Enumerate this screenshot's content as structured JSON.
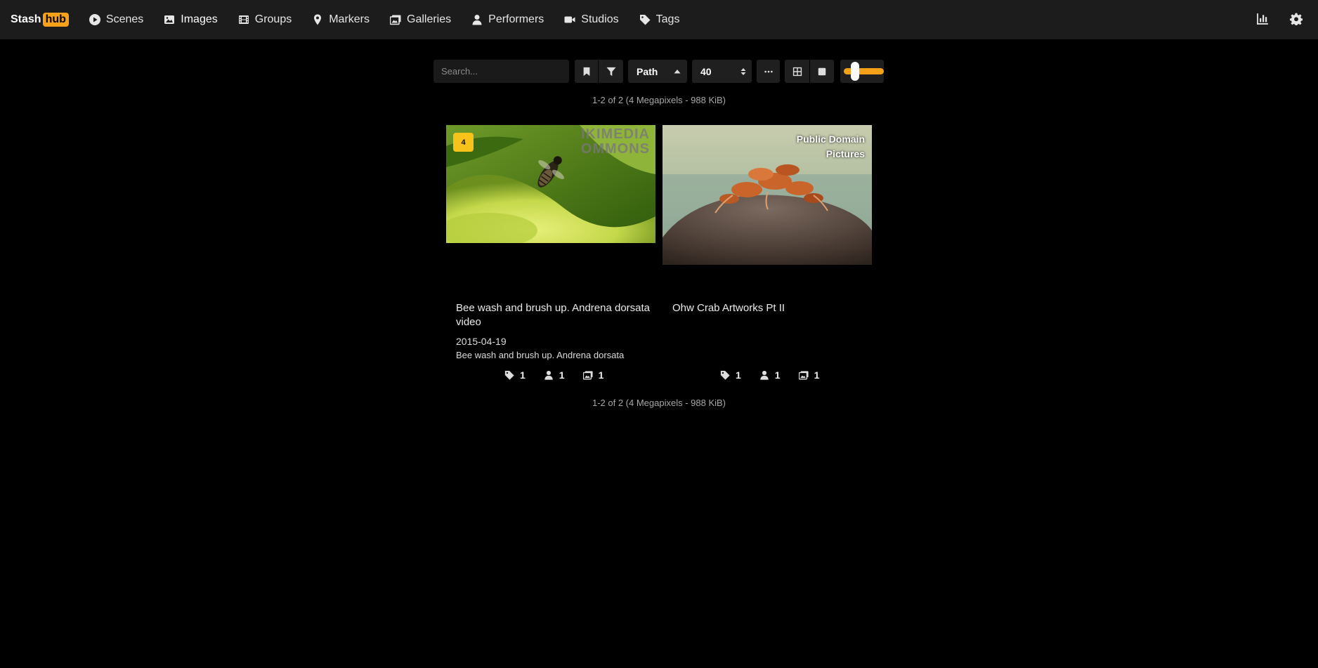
{
  "brand": {
    "stash": "Stash",
    "hub": "hub"
  },
  "nav": [
    {
      "label": "Scenes",
      "icon": "play-circle-icon"
    },
    {
      "label": "Images",
      "icon": "image-icon"
    },
    {
      "label": "Groups",
      "icon": "film-icon"
    },
    {
      "label": "Markers",
      "icon": "map-marker-icon"
    },
    {
      "label": "Galleries",
      "icon": "images-icon"
    },
    {
      "label": "Performers",
      "icon": "user-icon"
    },
    {
      "label": "Studios",
      "icon": "video-icon"
    },
    {
      "label": "Tags",
      "icon": "tag-icon"
    }
  ],
  "toolbar": {
    "search_placeholder": "Search...",
    "sort_by": "Path",
    "per_page": "40"
  },
  "pagination": {
    "summary": "1-2 of 2 (4 Megapixels - 988 KiB)"
  },
  "cards": [
    {
      "title": "Bee wash and brush up. Andrena dorsata video",
      "date": "2015-04-19",
      "details": "Bee wash and brush up. Andrena dorsata",
      "badge": "4",
      "watermark_line1": "IKIMEDIA",
      "watermark_line2": "OMMONS",
      "tags": "1",
      "performers": "1",
      "galleries": "1"
    },
    {
      "title": "Ohw Crab Artworks Pt II",
      "watermark_line1": "Public Domain",
      "watermark_line2": "Pictures",
      "tags": "1",
      "performers": "1",
      "galleries": "1"
    }
  ],
  "colors": {
    "accent": "#f7a11a",
    "badge": "#f7c21a",
    "navbar": "#1c1c1c",
    "background": "#000000"
  }
}
